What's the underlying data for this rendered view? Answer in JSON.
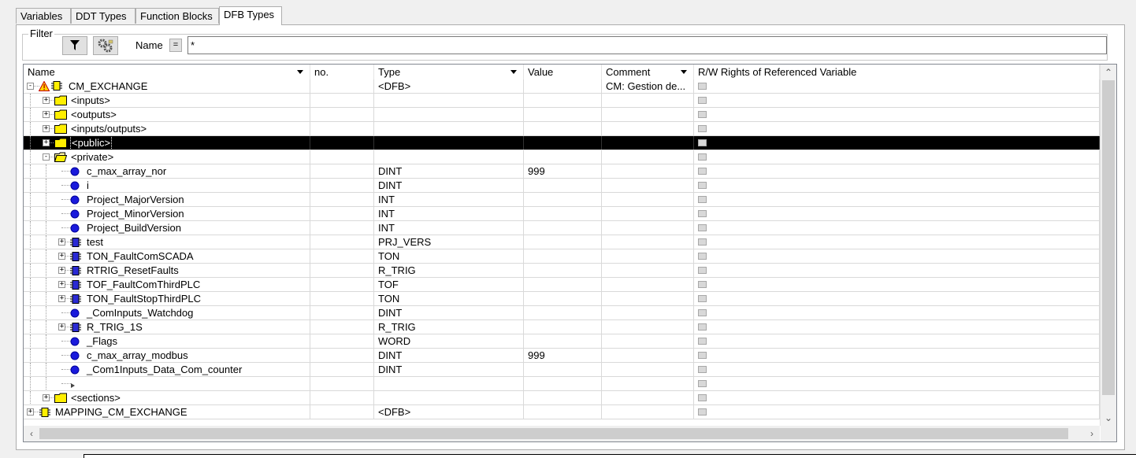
{
  "tabs": [
    {
      "label": "Variables",
      "active": false
    },
    {
      "label": "DDT Types",
      "active": false
    },
    {
      "label": "Function Blocks",
      "active": false
    },
    {
      "label": "DFB Types",
      "active": true
    }
  ],
  "filter": {
    "legend": "Filter",
    "name_label": "Name",
    "eq_label": "=",
    "value": "*"
  },
  "columns": [
    {
      "key": "name",
      "label": "Name",
      "sortable": true
    },
    {
      "key": "no",
      "label": "no.",
      "sortable": false
    },
    {
      "key": "type",
      "label": "Type",
      "sortable": true
    },
    {
      "key": "value",
      "label": "Value",
      "sortable": false
    },
    {
      "key": "comment",
      "label": "Comment",
      "sortable": true
    },
    {
      "key": "rw",
      "label": "R/W Rights of Referenced Variable",
      "sortable": false
    }
  ],
  "rows": [
    {
      "level": 0,
      "expander": "-",
      "icon": "dfb-warning-icon",
      "name": "CM_EXCHANGE",
      "type": "<DFB>",
      "value": "",
      "comment": "CM: Gestion de..."
    },
    {
      "level": 1,
      "expander": "+",
      "icon": "folder-icon",
      "name": "<inputs>",
      "type": "",
      "value": "",
      "comment": ""
    },
    {
      "level": 1,
      "expander": "+",
      "icon": "folder-icon",
      "name": "<outputs>",
      "type": "",
      "value": "",
      "comment": ""
    },
    {
      "level": 1,
      "expander": "+",
      "icon": "folder-icon",
      "name": "<inputs/outputs>",
      "type": "",
      "value": "",
      "comment": ""
    },
    {
      "level": 1,
      "expander": "+",
      "icon": "folder-icon",
      "name": "<public>",
      "type": "",
      "value": "",
      "comment": "",
      "selected": true
    },
    {
      "level": 1,
      "expander": "-",
      "icon": "folder-open-icon",
      "name": "<private>",
      "type": "",
      "value": "",
      "comment": ""
    },
    {
      "level": 2,
      "expander": "",
      "icon": "variable-icon",
      "name": "c_max_array_nor",
      "type": "DINT",
      "value": "999",
      "comment": ""
    },
    {
      "level": 2,
      "expander": "",
      "icon": "variable-icon",
      "name": "i",
      "type": "DINT",
      "value": "",
      "comment": ""
    },
    {
      "level": 2,
      "expander": "",
      "icon": "variable-icon",
      "name": "Project_MajorVersion",
      "type": "INT",
      "value": "",
      "comment": ""
    },
    {
      "level": 2,
      "expander": "",
      "icon": "variable-icon",
      "name": "Project_MinorVersion",
      "type": "INT",
      "value": "",
      "comment": ""
    },
    {
      "level": 2,
      "expander": "",
      "icon": "variable-icon",
      "name": "Project_BuildVersion",
      "type": "INT",
      "value": "",
      "comment": ""
    },
    {
      "level": 2,
      "expander": "+",
      "icon": "structure-icon",
      "name": "test",
      "type": "PRJ_VERS",
      "value": "",
      "comment": ""
    },
    {
      "level": 2,
      "expander": "+",
      "icon": "structure-icon",
      "name": "TON_FaultComSCADA",
      "type": "TON",
      "value": "",
      "comment": ""
    },
    {
      "level": 2,
      "expander": "+",
      "icon": "structure-icon",
      "name": "RTRIG_ResetFaults",
      "type": "R_TRIG",
      "value": "",
      "comment": ""
    },
    {
      "level": 2,
      "expander": "+",
      "icon": "structure-icon",
      "name": "TOF_FaultComThirdPLC",
      "type": "TOF",
      "value": "",
      "comment": ""
    },
    {
      "level": 2,
      "expander": "+",
      "icon": "structure-icon",
      "name": "TON_FaultStopThirdPLC",
      "type": "TON",
      "value": "",
      "comment": ""
    },
    {
      "level": 2,
      "expander": "",
      "icon": "variable-icon",
      "name": "_ComInputs_Watchdog",
      "type": "DINT",
      "value": "",
      "comment": ""
    },
    {
      "level": 2,
      "expander": "+",
      "icon": "structure-icon",
      "name": "R_TRIG_1S",
      "type": "R_TRIG",
      "value": "",
      "comment": ""
    },
    {
      "level": 2,
      "expander": "",
      "icon": "variable-icon",
      "name": "_Flags",
      "type": "WORD",
      "value": "",
      "comment": ""
    },
    {
      "level": 2,
      "expander": "",
      "icon": "variable-icon",
      "name": "c_max_array_modbus",
      "type": "DINT",
      "value": "999",
      "comment": ""
    },
    {
      "level": 2,
      "expander": "",
      "icon": "variable-icon",
      "name": "_Com1Inputs_Data_Com_counter",
      "type": "DINT",
      "value": "",
      "comment": ""
    },
    {
      "level": 2,
      "expander": "",
      "icon": "new-row-icon",
      "name": "",
      "type": "",
      "value": "",
      "comment": ""
    },
    {
      "level": 1,
      "expander": "+",
      "icon": "folder-icon",
      "name": "<sections>",
      "type": "",
      "value": "",
      "comment": ""
    },
    {
      "level": 0,
      "expander": "+",
      "icon": "dfb-icon",
      "name": "MAPPING_CM_EXCHANGE",
      "type": "<DFB>",
      "value": "",
      "comment": ""
    }
  ]
}
